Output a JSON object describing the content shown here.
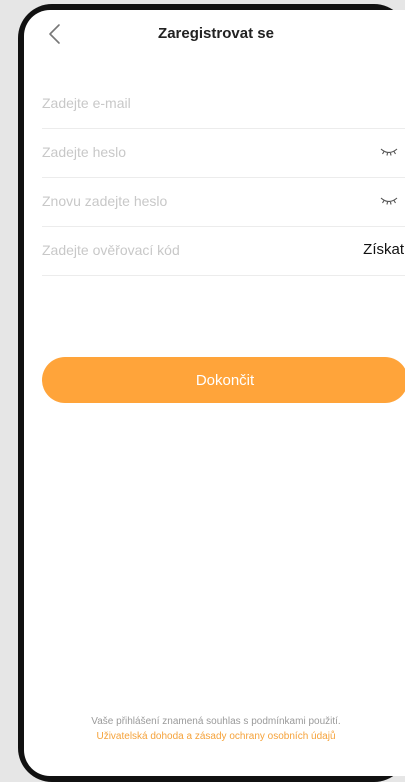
{
  "nav": {
    "title": "Zaregistrovat se"
  },
  "form": {
    "email_placeholder": "Zadejte e-mail",
    "password_placeholder": "Zadejte heslo",
    "password_repeat_placeholder": "Znovu zadejte heslo",
    "code_placeholder": "Zadejte ověřovací kód",
    "get_code_label": "Získat"
  },
  "submit_label": "Dokončit",
  "footer": {
    "consent_text": "Vaše přihlášení znamená souhlas s podmínkami použití.",
    "agreement_link": "Uživatelská dohoda a zásady ochrany osobních údajů"
  },
  "colors": {
    "accent": "#ffa43a",
    "link": "#f5a23a",
    "placeholder": "#c8c8c8"
  },
  "icons": {
    "back": "chevron-left-icon",
    "password_visibility": "eye-closed-icon"
  }
}
